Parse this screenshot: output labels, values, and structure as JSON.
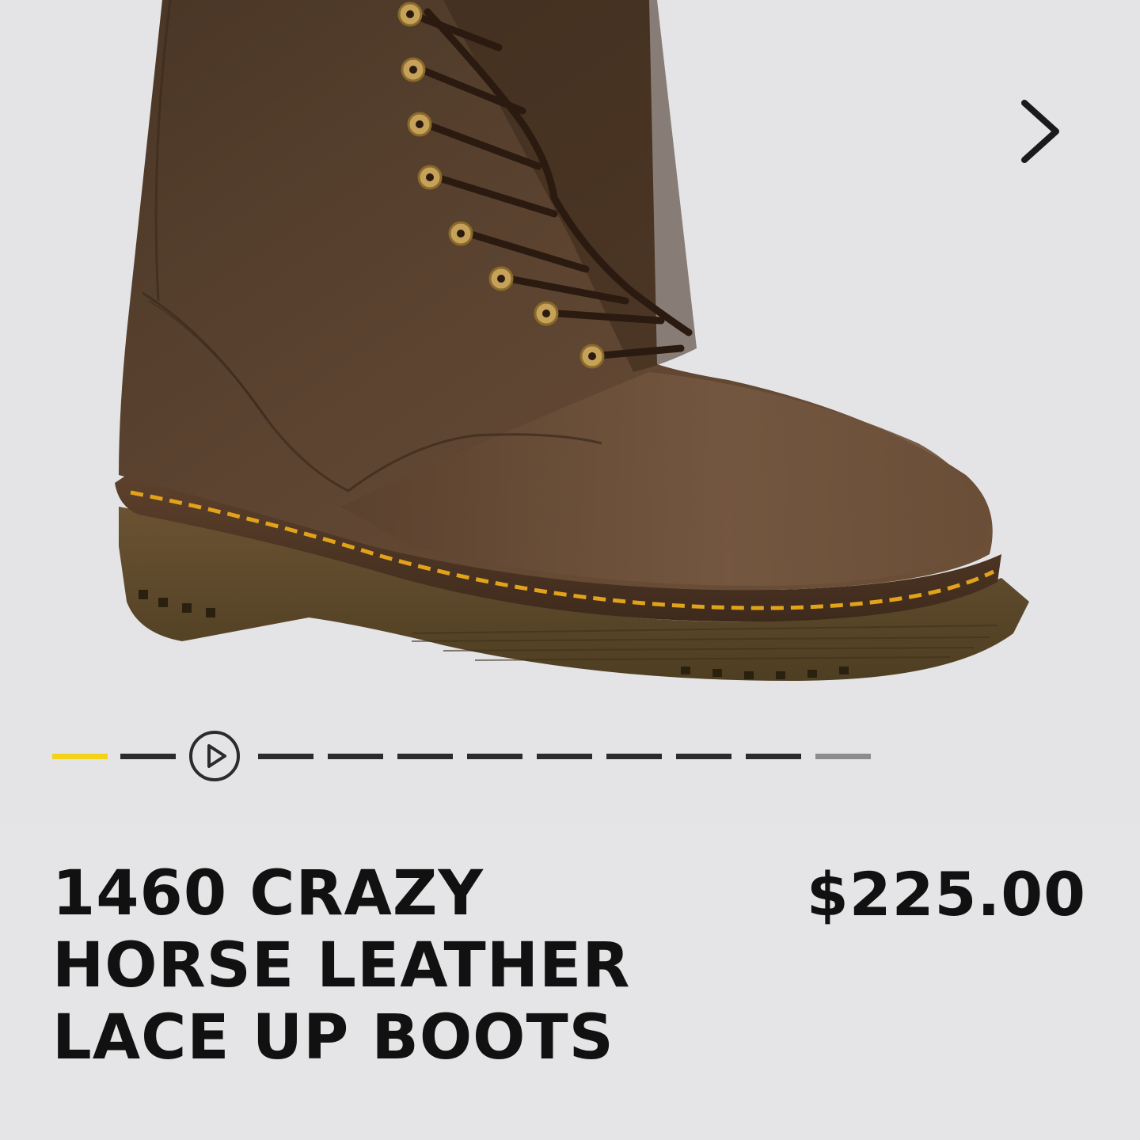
{
  "product": {
    "title": "1460 CRAZY HORSE LEATHER LACE UP BOOTS",
    "price": "$225.00"
  },
  "gallery": {
    "image": "boot-photo",
    "next_icon": "chevron-right-icon",
    "video_icon": "play-icon",
    "slide_count": 12,
    "active_slide": 1
  },
  "colors": {
    "background": "#e5e5e7",
    "active_indicator": "#f3d21a",
    "indicator": "#2b2b2b",
    "text": "#111111"
  }
}
